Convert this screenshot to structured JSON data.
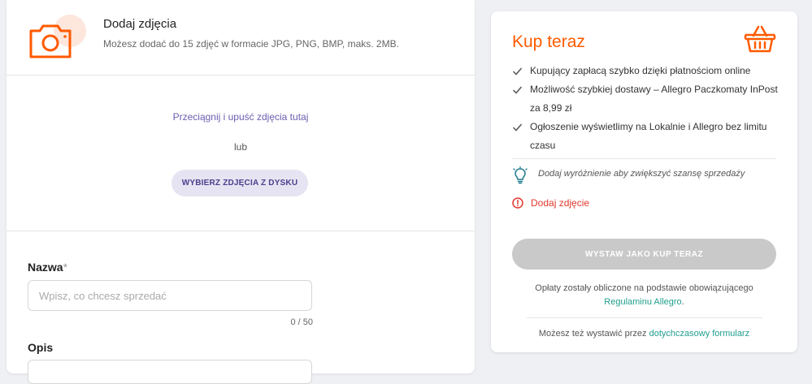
{
  "photos": {
    "title": "Dodaj zdjęcia",
    "subtitle": "Możesz dodać do 15 zdjęć w formacie JPG, PNG, BMP, maks. 2MB.",
    "drop_text": "Przeciągnij i upuść zdjęcia tutaj",
    "or_text": "lub",
    "choose_button": "WYBIERZ ZDJĘCIA Z DYSKU",
    "icon": "camera-icon"
  },
  "form": {
    "name_label": "Nazwa",
    "name_required_mark": "*",
    "name_placeholder": "Wpisz, co chcesz sprzedać",
    "name_value": "",
    "name_counter": "0 / 50",
    "description_label": "Opis"
  },
  "buy_now": {
    "title": "Kup teraz",
    "icon": "basket-icon",
    "features": [
      "Kupujący zapłacą szybko dzięki płatnościom online",
      "Możliwość szybkiej dostawy – Allegro Paczkomaty InPost za 8,99 zł",
      "Ogłoszenie wyświetlimy na Lokalnie i Allegro bez limitu czasu"
    ],
    "tip": "Dodaj wyróżnienie aby zwiększyć szansę sprzedaży",
    "error": "Dodaj zdjęcie",
    "submit_button": "WYSTAW JAKO KUP TERAZ",
    "fees_text": "Opłaty zostały obliczone na podstawie obowiązującego",
    "fees_link": "Regulaminu Allegro",
    "fees_end": ".",
    "alt_text": "Możesz też wystawić przez",
    "alt_link": "dotychczasowy formularz"
  },
  "colors": {
    "accent": "#ff5a00",
    "link": "#1f9e8d",
    "error": "#e2372d",
    "drop_text": "#6b5fb0",
    "button_disabled": "#c9c9c9"
  }
}
